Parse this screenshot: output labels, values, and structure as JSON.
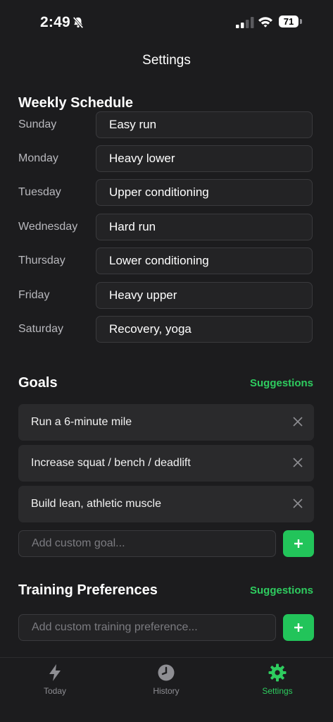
{
  "status_bar": {
    "time": "2:49",
    "battery": "71"
  },
  "nav": {
    "title": "Settings"
  },
  "weekly_schedule": {
    "heading": "Weekly Schedule",
    "days": [
      {
        "day": "Sunday",
        "plan": "Easy run"
      },
      {
        "day": "Monday",
        "plan": "Heavy lower"
      },
      {
        "day": "Tuesday",
        "plan": "Upper conditioning"
      },
      {
        "day": "Wednesday",
        "plan": "Hard run"
      },
      {
        "day": "Thursday",
        "plan": "Lower conditioning"
      },
      {
        "day": "Friday",
        "plan": "Heavy upper"
      },
      {
        "day": "Saturday",
        "plan": "Recovery, yoga"
      }
    ]
  },
  "goals": {
    "heading": "Goals",
    "suggestions_label": "Suggestions",
    "items": [
      {
        "text": "Run a 6-minute mile"
      },
      {
        "text": "Increase squat / bench / deadlift"
      },
      {
        "text": "Build lean, athletic muscle"
      }
    ],
    "input_placeholder": "Add custom goal...",
    "add_label": "+"
  },
  "training_preferences": {
    "heading": "Training Preferences",
    "suggestions_label": "Suggestions",
    "input_placeholder": "Add custom training preference...",
    "add_label": "+"
  },
  "tab_bar": {
    "tabs": [
      {
        "label": "Today",
        "icon": "bolt-icon"
      },
      {
        "label": "History",
        "icon": "clock-icon"
      },
      {
        "label": "Settings",
        "icon": "gear-icon"
      }
    ]
  },
  "colors": {
    "accent": "#2ecc5f",
    "background": "#1c1c1e",
    "field": "#232325",
    "card": "#2a2a2c"
  }
}
